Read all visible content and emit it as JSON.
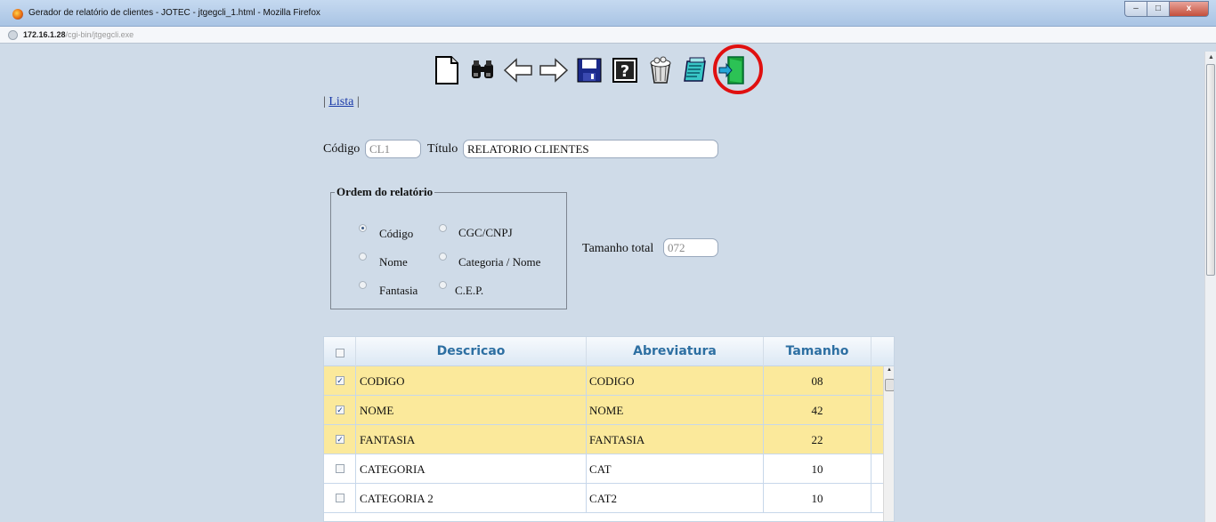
{
  "window": {
    "title": "Gerador de relatório de clientes - JOTEC - jtgegcli_1.html - Mozilla Firefox",
    "min": "–",
    "max": "□",
    "close": "x"
  },
  "urlbar": {
    "host": "172.16.1.28",
    "path": "/cgi-bin/jtgegcli.exe"
  },
  "toolbar": {
    "icons": [
      "new-document-icon",
      "binoculars-icon",
      "back-arrow-icon",
      "forward-arrow-icon",
      "save-disk-icon",
      "help-icon",
      "trash-icon",
      "report-notepad-icon",
      "exit-door-icon"
    ]
  },
  "nav": {
    "prefix": "| ",
    "lista": "Lista",
    "suffix": " |"
  },
  "form": {
    "codigo_label": "Código",
    "codigo_value": "CL1",
    "titulo_label": "Título",
    "titulo_value": "RELATORIO CLIENTES",
    "tamanho_label": "Tamanho total",
    "tamanho_value": "072"
  },
  "ordem": {
    "legend": "Ordem do relatório",
    "options": [
      {
        "label": "Código",
        "selected": true
      },
      {
        "label": "CGC/CNPJ",
        "selected": false
      },
      {
        "label": "Nome",
        "selected": false
      },
      {
        "label": "Categoria / Nome",
        "selected": false
      },
      {
        "label": "Fantasia",
        "selected": false
      },
      {
        "label": "C.E.P.",
        "selected": false
      }
    ]
  },
  "table": {
    "headers": [
      "Descricao",
      "Abreviatura",
      "Tamanho"
    ],
    "rows": [
      {
        "checked": true,
        "descricao": "CODIGO",
        "abreviatura": "CODIGO",
        "tamanho": "08"
      },
      {
        "checked": true,
        "descricao": "NOME",
        "abreviatura": "NOME",
        "tamanho": "42"
      },
      {
        "checked": true,
        "descricao": "FANTASIA",
        "abreviatura": "FANTASIA",
        "tamanho": "22"
      },
      {
        "checked": false,
        "descricao": "CATEGORIA",
        "abreviatura": "CAT",
        "tamanho": "10"
      },
      {
        "checked": false,
        "descricao": "CATEGORIA 2",
        "abreviatura": "CAT2",
        "tamanho": "10"
      }
    ]
  },
  "colors": {
    "selected_row": "#fbe99b",
    "header_text": "#2d6fa2",
    "highlight_ring": "#e01010"
  }
}
